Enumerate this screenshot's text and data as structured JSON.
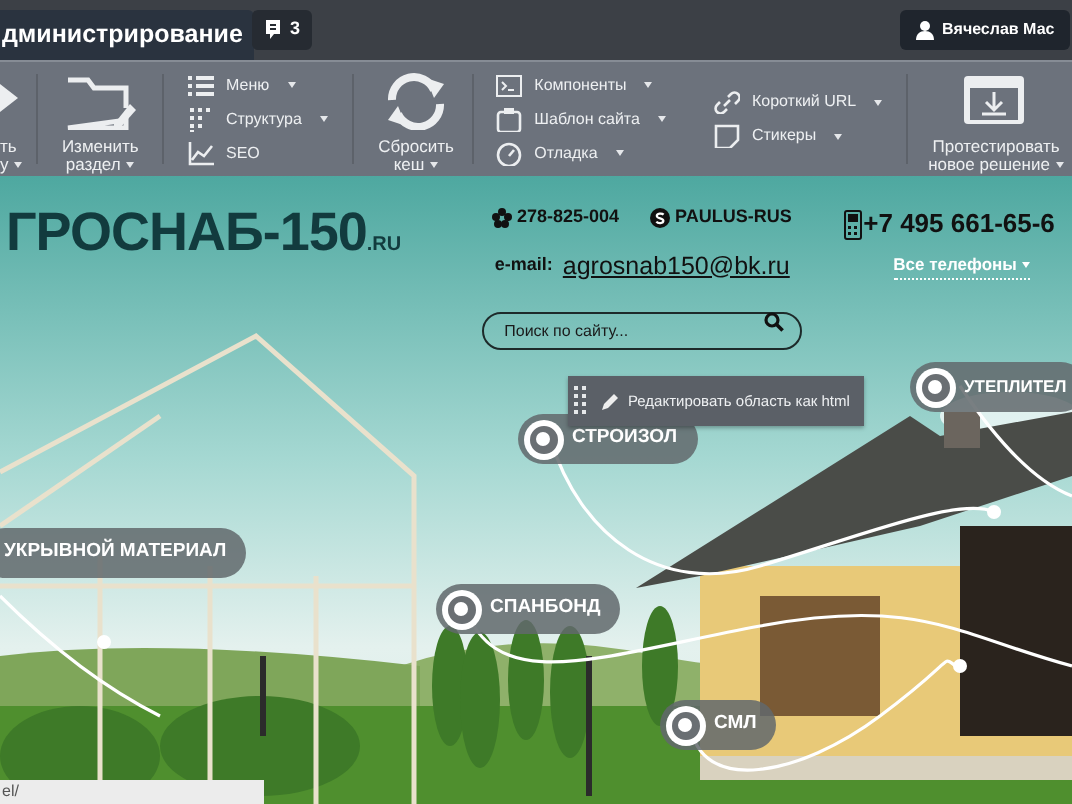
{
  "admin_bar": {
    "mode_tab": "дминистрирование",
    "notifications": {
      "count": "3"
    },
    "user": "Вячеслав Мас"
  },
  "toolbar": {
    "groups": [
      {
        "kind": "large",
        "lines": [
          "ть",
          "у"
        ],
        "dropdown": true
      },
      {
        "kind": "large",
        "lines": [
          "Изменить",
          "раздел"
        ],
        "dropdown": true
      },
      {
        "kind": "list",
        "items": [
          {
            "label": "Меню",
            "dropdown": true
          },
          {
            "label": "Структура",
            "dropdown": true
          },
          {
            "label": "SEO",
            "dropdown": false
          }
        ]
      },
      {
        "kind": "large",
        "lines": [
          "Сбросить",
          "кеш"
        ],
        "dropdown": true
      },
      {
        "kind": "list",
        "items": [
          {
            "label": "Компоненты",
            "dropdown": true
          },
          {
            "label": "Шаблон сайта",
            "dropdown": true
          },
          {
            "label": "Отладка",
            "dropdown": true
          }
        ]
      },
      {
        "kind": "list",
        "items": [
          {
            "label": "Короткий URL",
            "dropdown": true
          },
          {
            "label": "Стикеры",
            "dropdown": true
          }
        ]
      },
      {
        "kind": "large",
        "lines": [
          "Протестировать",
          "новое решение"
        ],
        "dropdown": true
      }
    ]
  },
  "site_header": {
    "logo": "ГРОСНАБ-150",
    "logo_suffix": ".RU",
    "icq": "278-825-004",
    "skype": "PAULUS-RUS",
    "email_label": "e-mail:",
    "email": "agrosnab150@bk.ru",
    "phone": "+7 495 661-65-6",
    "all_phones": "Все телефоны",
    "search": {
      "placeholder": "Поиск по сайту..."
    }
  },
  "edit_popup": {
    "label": "Редактировать область как html"
  },
  "hotspots": [
    {
      "kind": "marker",
      "label": "УТЕПЛИТЕЛ"
    },
    {
      "kind": "marker",
      "label": "СТРОИЗОЛ"
    },
    {
      "kind": "plain",
      "label": "УКРЫВНОЙ МАТЕРИАЛ"
    },
    {
      "kind": "marker",
      "label": "СПАНБОНД"
    },
    {
      "kind": "marker",
      "label": "СМЛ"
    }
  ],
  "status_bar": {
    "url": "el/"
  }
}
